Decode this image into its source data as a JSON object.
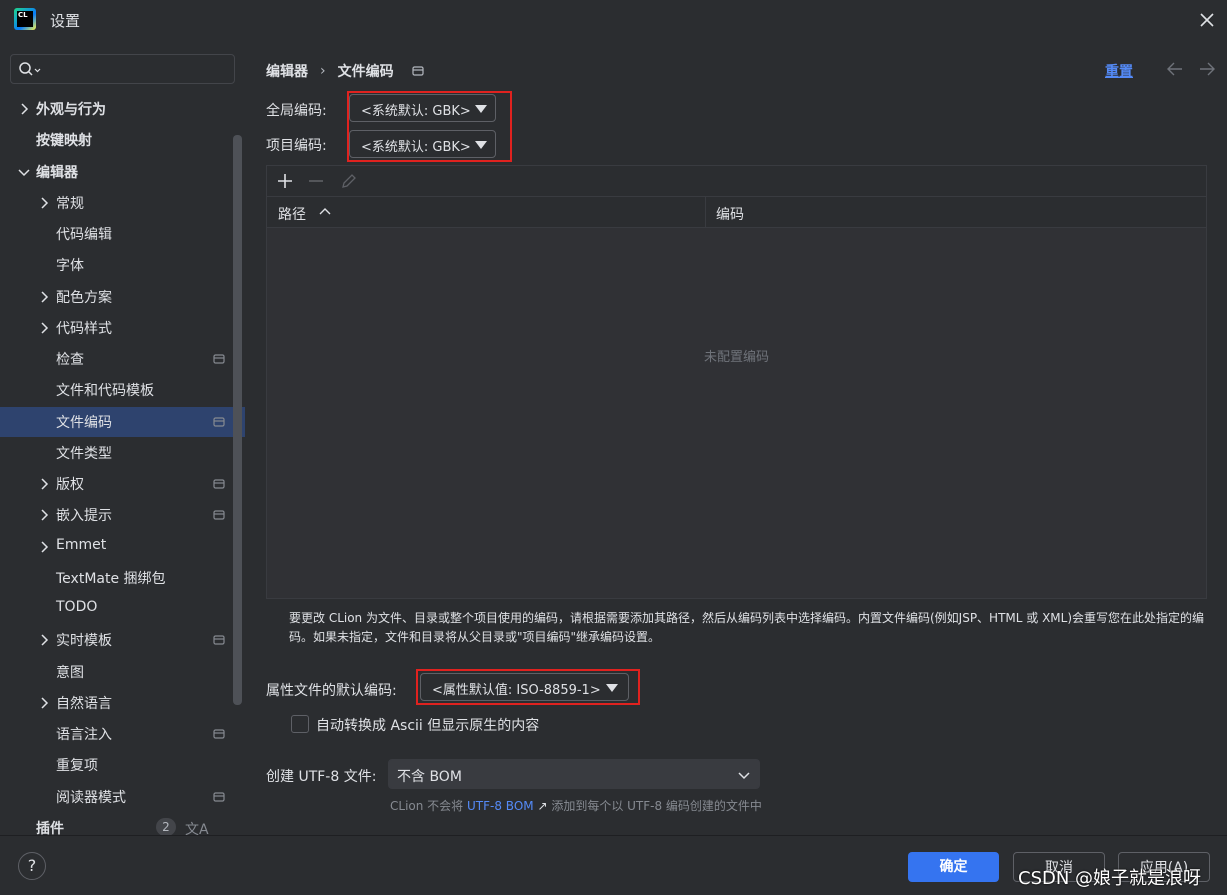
{
  "window": {
    "title": "设置",
    "logo_text": "CL"
  },
  "search": {
    "placeholder": ""
  },
  "sidebar": {
    "items": [
      {
        "label": "外观与行为",
        "expandable": true,
        "expanded": false,
        "bold": true
      },
      {
        "label": "按键映射",
        "bold": true
      },
      {
        "label": "编辑器",
        "expandable": true,
        "expanded": true,
        "bold": true
      },
      {
        "label": "常规",
        "expandable": true
      },
      {
        "label": "代码编辑"
      },
      {
        "label": "字体"
      },
      {
        "label": "配色方案",
        "expandable": true
      },
      {
        "label": "代码样式",
        "expandable": true
      },
      {
        "label": "检查",
        "project_icon": true
      },
      {
        "label": "文件和代码模板"
      },
      {
        "label": "文件编码",
        "selected": true,
        "project_icon": true
      },
      {
        "label": "文件类型"
      },
      {
        "label": "版权",
        "expandable": true,
        "project_icon": true
      },
      {
        "label": "嵌入提示",
        "expandable": true,
        "project_icon": true
      },
      {
        "label": "Emmet",
        "expandable": true
      },
      {
        "label": "TextMate 捆绑包"
      },
      {
        "label": "TODO"
      },
      {
        "label": "实时模板",
        "expandable": true,
        "project_icon": true
      },
      {
        "label": "意图"
      },
      {
        "label": "自然语言",
        "expandable": true
      },
      {
        "label": "语言注入",
        "project_icon": true
      },
      {
        "label": "重复项"
      },
      {
        "label": "阅读器模式",
        "project_icon": true
      },
      {
        "label": "插件",
        "bold": true,
        "badge": "2",
        "translate_icon": "文A"
      }
    ]
  },
  "breadcrumb": {
    "parent": "编辑器",
    "separator": "›",
    "current": "文件编码"
  },
  "header": {
    "reset_label": "重置"
  },
  "encoding": {
    "global_label": "全局编码:",
    "global_value": "<系统默认: GBK>",
    "project_label": "项目编码:",
    "project_value": "<系统默认: GBK>"
  },
  "table": {
    "col_path": "路径",
    "col_encoding": "编码",
    "empty_text": "未配置编码"
  },
  "hint": "要更改 CLion 为文件、目录或整个项目使用的编码，请根据需要添加其路径，然后从编码列表中选择编码。内置文件编码(例如JSP、HTML 或 XML)会重写您在此处指定的编码。如果未指定，文件和目录将从父目录或\"项目编码\"继承编码设置。",
  "properties": {
    "label": "属性文件的默认编码:",
    "value": "<属性默认值: ISO-8859-1>",
    "checkbox_label": "自动转换成 Ascii 但显示原生的内容",
    "checkbox_checked": false
  },
  "utf8": {
    "label": "创建 UTF-8 文件:",
    "value": "不含 BOM",
    "note_prefix": "CLion 不会将",
    "note_link": "UTF-8 BOM",
    "note_suffix": "添加到每个以 UTF-8 编码创建的文件中"
  },
  "footer": {
    "help": "?",
    "ok": "确定",
    "cancel": "取消",
    "apply": "应用(A)",
    "watermark": "CSDN @娘子就是浪呀"
  },
  "colors": {
    "accent": "#3574f0",
    "link": "#548af7",
    "selected_row": "#2e436e",
    "highlight_box": "#e0221f"
  }
}
